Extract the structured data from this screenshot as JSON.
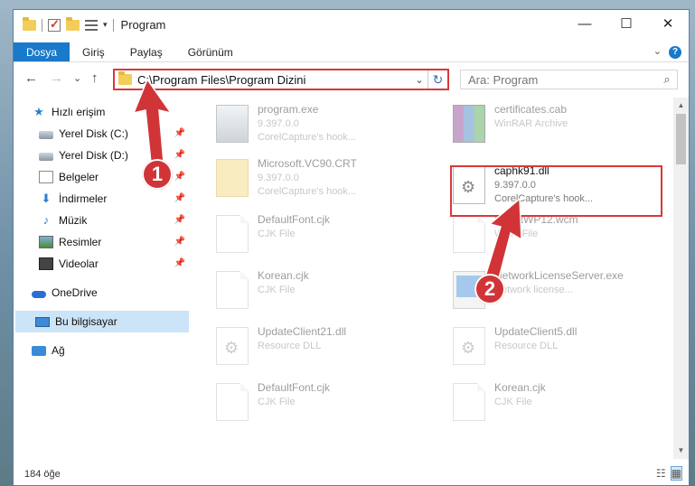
{
  "window": {
    "title": "Program",
    "controls": {
      "minimize": "—",
      "maximize": "☐",
      "close": "✕"
    }
  },
  "ribbon": {
    "tabs": [
      "Dosya",
      "Giriş",
      "Paylaş",
      "Görünüm"
    ]
  },
  "nav": {
    "back": "←",
    "forward": "→",
    "recent": "⌄",
    "up": "↑",
    "address": "C:\\Program Files\\Program Dizini",
    "search_placeholder": "Ara: Program"
  },
  "sidebar": {
    "items": [
      {
        "label": "Hızlı erişim",
        "icon": "star-icon"
      },
      {
        "label": "Yerel Disk (C:)",
        "icon": "drive-icon",
        "pinned": true
      },
      {
        "label": "Yerel Disk (D:)",
        "icon": "drive-icon",
        "pinned": true
      },
      {
        "label": "Belgeler",
        "icon": "documents-icon",
        "pinned": true
      },
      {
        "label": "İndirmeler",
        "icon": "download-icon",
        "pinned": true
      },
      {
        "label": "Müzik",
        "icon": "music-icon",
        "pinned": true
      },
      {
        "label": "Resimler",
        "icon": "pictures-icon",
        "pinned": true
      },
      {
        "label": "Videolar",
        "icon": "videos-icon",
        "pinned": true
      },
      {
        "label": "OneDrive",
        "icon": "cloud-icon"
      },
      {
        "label": "Bu bilgisayar",
        "icon": "computer-icon",
        "selected": true
      },
      {
        "label": "Ağ",
        "icon": "network-icon"
      }
    ]
  },
  "files": [
    {
      "name": "program.exe",
      "line1": "9.397.0.0",
      "line2": "CorelCapture's hook...",
      "icon": "exe-icon"
    },
    {
      "name": "certificates.cab",
      "line1": "WinRAR Archive",
      "line2": "",
      "icon": "winrar-icon"
    },
    {
      "name": "Microsoft.VC90.CRT",
      "line1": "9.397.0.0",
      "line2": "CorelCapture's hook...",
      "icon": "folder-icon"
    },
    {
      "name": "caphk91.dll",
      "line1": "9.397.0.0",
      "line2": "CorelCapture's hook...",
      "icon": "dll-icon"
    },
    {
      "name": "DefaultFont.cjk",
      "line1": "CJK File",
      "line2": "",
      "icon": "file-icon"
    },
    {
      "name": "SmartWP12.wcm",
      "line1": "WCM File",
      "line2": "",
      "icon": "file-icon"
    },
    {
      "name": "Korean.cjk",
      "line1": "CJK File",
      "line2": "",
      "icon": "file-icon"
    },
    {
      "name": "NetworkLicenseServer.exe",
      "line1": "Network license...",
      "line2": "",
      "icon": "app-icon"
    },
    {
      "name": "UpdateClient21.dll",
      "line1": "Resource DLL",
      "line2": "",
      "icon": "dll-icon"
    },
    {
      "name": "UpdateClient5.dll",
      "line1": "Resource DLL",
      "line2": "",
      "icon": "dll-icon"
    },
    {
      "name": "DefaultFont.cjk",
      "line1": "CJK File",
      "line2": "",
      "icon": "file-icon"
    },
    {
      "name": "Korean.cjk",
      "line1": "CJK File",
      "line2": "",
      "icon": "file-icon"
    }
  ],
  "status": {
    "count": "184 öğe"
  },
  "callouts": [
    "1",
    "2"
  ],
  "colors": {
    "accent": "#1979ca",
    "highlight": "#d9393b",
    "selected": "#cce4f7"
  }
}
